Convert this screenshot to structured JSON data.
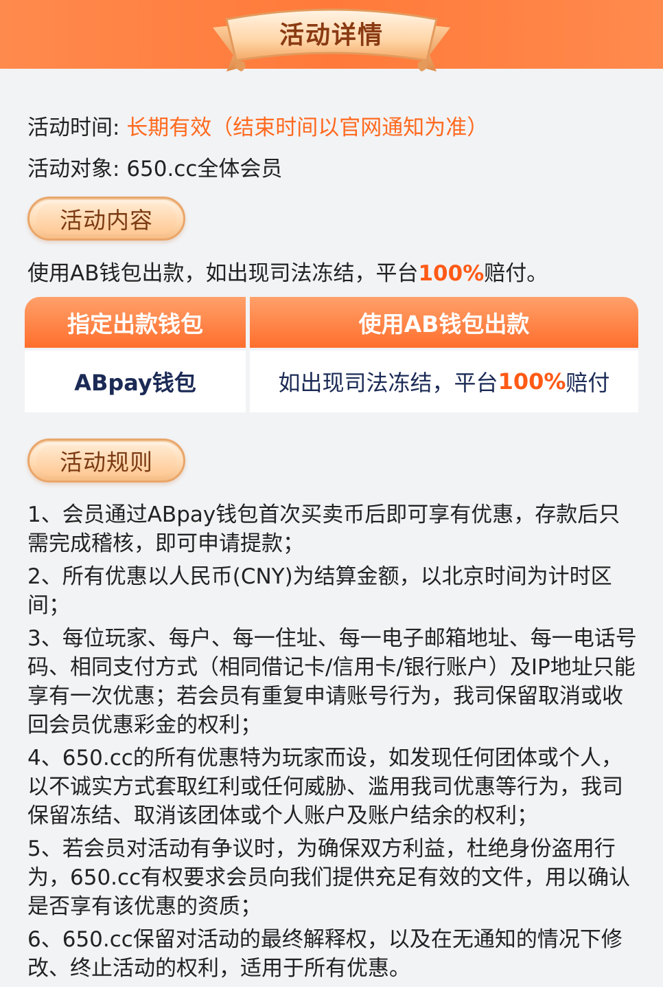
{
  "header": {
    "title": "活动详情"
  },
  "info": {
    "time_label": "活动时间: ",
    "time_value": "长期有效（结束时间以官网通知为准）",
    "target_label": "活动对象: ",
    "target_value": "650.cc全体会员"
  },
  "content_section": {
    "title": "活动内容",
    "description_prefix": "使用AB钱包出款，如出现司法冻结，平台",
    "description_highlight": "100%",
    "description_suffix": "赔付。"
  },
  "table": {
    "headers": [
      "指定出款钱包",
      "使用AB钱包出款"
    ],
    "row": {
      "wallet": "ABpay钱包",
      "note_prefix": "如出现司法冻结，平台",
      "note_highlight": "100%",
      "note_suffix": "赔付"
    }
  },
  "rules_section": {
    "title": "活动规则",
    "items": [
      "1、会员通过ABpay钱包首次买卖币后即可享有优惠，存款后只需完成稽核，即可申请提款；",
      "2、所有优惠以人民币(CNY)为结算金额，以北京时间为计时区间；",
      "3、每位玩家、每户、每一住址、每一电子邮箱地址、每一电话号码、相同支付方式（相同借记卡/信用卡/银行账户）及IP地址只能享有一次优惠；若会员有重复申请账号行为，我司保留取消或收回会员优惠彩金的权利；",
      "4、650.cc的所有优惠特为玩家而设，如发现任何团体或个人，以不诚实方式套取红利或任何威胁、滥用我司优惠等行为，我司保留冻结、取消该团体或个人账户及账户结余的权利；",
      "5、若会员对活动有争议时，为确保双方利益，杜绝身份盗用行为，650.cc有权要求会员向我们提供充足有效的文件，用以确认是否享有该优惠的资质；",
      "6、650.cc保留对活动的最终解释权，以及在无通知的情况下修改、终止活动的权利，适用于所有优惠。"
    ]
  }
}
